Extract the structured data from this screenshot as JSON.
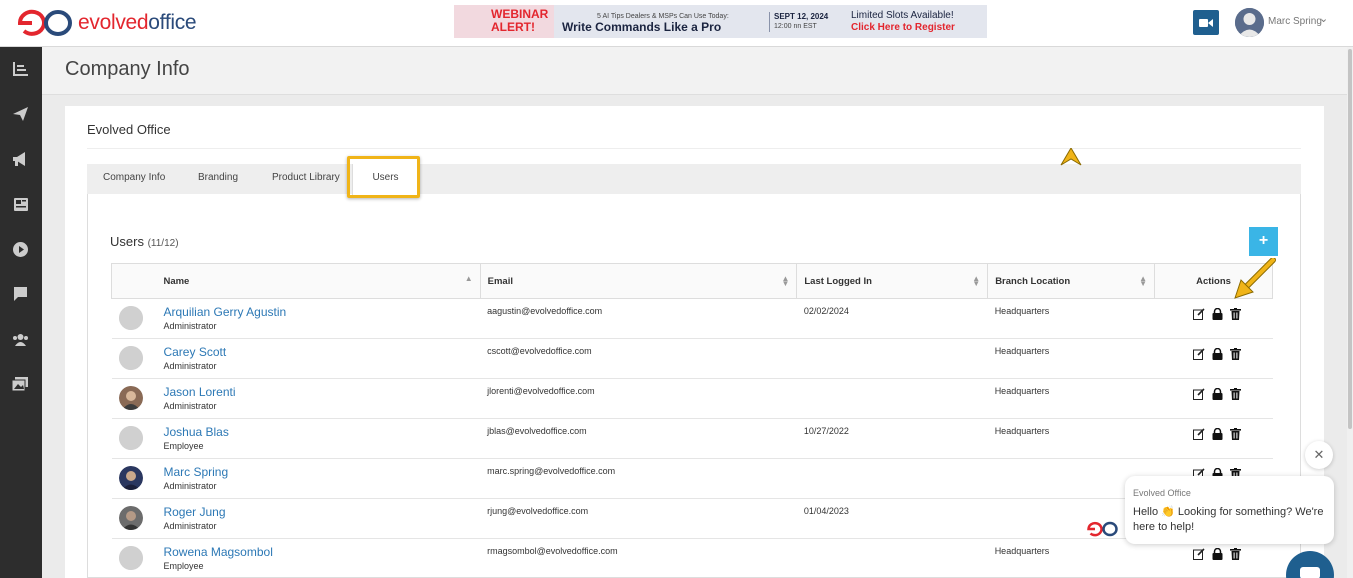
{
  "app": {
    "brand": {
      "part1": "evolved",
      "part2": "office"
    },
    "colors": {
      "brand_red": "#e3262e",
      "brand_navy": "#2a4a7a",
      "link": "#2c78b5",
      "accent_blue": "#3ab5e6",
      "highlight": "#f0b418",
      "sidebar": "#2d2d2d"
    }
  },
  "banner": {
    "alert": "WEBINAR ALERT!",
    "sub": "5 AI Tips Dealers & MSPs Can Use Today:",
    "headline": "Write Commands Like a Pro",
    "date": "SEPT 12, 2024",
    "time": "12:00 nn EST",
    "slots": "Limited Slots Available!",
    "register": "Click Here to Register"
  },
  "header": {
    "user_name": "Marc Spring",
    "video_icon": "video-icon"
  },
  "sidebar": {
    "items": [
      {
        "icon": "dashboard-icon"
      },
      {
        "icon": "send-icon"
      },
      {
        "icon": "megaphone-icon"
      },
      {
        "icon": "newspaper-icon"
      },
      {
        "icon": "play-icon"
      },
      {
        "icon": "chat-icon"
      },
      {
        "icon": "users-icon"
      },
      {
        "icon": "gallery-icon"
      }
    ]
  },
  "page": {
    "title": "Company Info",
    "card_title": "Evolved Office",
    "tabs": [
      "Company Info",
      "Branding",
      "Product Library",
      "Users"
    ],
    "active_tab": "Users"
  },
  "users": {
    "title": "Users",
    "count": "(11/12)",
    "add_label": "+",
    "columns": [
      "Name",
      "Email",
      "Last Logged In",
      "Branch Location",
      "Actions"
    ],
    "rows": [
      {
        "name": "Arquilian Gerry Agustin",
        "role": "Administrator",
        "email": "aagustin@evolvedoffice.com",
        "last": "02/02/2024",
        "branch": "Headquarters"
      },
      {
        "name": "Carey Scott",
        "role": "Administrator",
        "email": "cscott@evolvedoffice.com",
        "last": "",
        "branch": "Headquarters"
      },
      {
        "name": "Jason Lorenti",
        "role": "Administrator",
        "email": "jlorenti@evolvedoffice.com",
        "last": "",
        "branch": "Headquarters"
      },
      {
        "name": "Joshua Blas",
        "role": "Employee",
        "email": "jblas@evolvedoffice.com",
        "last": "10/27/2022",
        "branch": "Headquarters"
      },
      {
        "name": "Marc Spring",
        "role": "Administrator",
        "email": "marc.spring@evolvedoffice.com",
        "last": "",
        "branch": ""
      },
      {
        "name": "Roger Jung",
        "role": "Administrator",
        "email": "rjung@evolvedoffice.com",
        "last": "01/04/2023",
        "branch": ""
      },
      {
        "name": "Rowena Magsombol",
        "role": "Employee",
        "email": "rmagsombol@evolvedoffice.com",
        "last": "",
        "branch": "Headquarters"
      }
    ]
  },
  "chat": {
    "from": "Evolved Office",
    "message": "Hello 👏 Looking for something? We're here to help!",
    "close": "✕"
  }
}
